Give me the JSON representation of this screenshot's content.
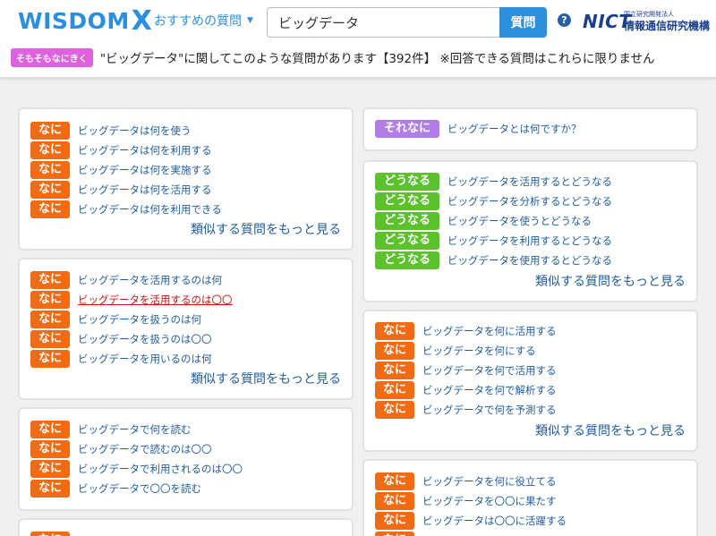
{
  "header": {
    "logo_text": "WISDOM",
    "logo_x": "X",
    "nav_dropdown": "おすすめの質問",
    "search_value": "ビッグデータ",
    "search_button": "質問",
    "help": "?",
    "nict_mark": "NICT",
    "nict_small": "国立研究開発法人",
    "nict_big": "情報通信研究機構"
  },
  "info_bar": {
    "badge": "そもそもなにきく",
    "text": "\"ビッグデータ\"に関してこのような質問があります【392件】 ※回答できる質問はこれらに限りません"
  },
  "colors": {
    "accent": "#2b8fe0",
    "tag_nani": "#f26a12",
    "tag_dounaru": "#5bc22c",
    "tag_sorenani": "#b07ee6",
    "link": "#1f5c9e",
    "visited_link": "#d01010"
  },
  "more_label": "類似する質問をもっと見る",
  "cards": [
    {
      "tag": "なに",
      "items": [
        "ビッグデータは何を使う",
        "ビッグデータは何を利用する",
        "ビッグデータは何を実施する",
        "ビッグデータは何を活用する",
        "ビッグデータは何を利用できる"
      ]
    },
    {
      "tag": "なに",
      "items": [
        "ビッグデータを活用するのは何",
        "ビッグデータを活用するのは〇〇",
        "ビッグデータを扱うのは何",
        "ビッグデータを扱うのは〇〇",
        "ビッグデータを用いるのは何"
      ]
    },
    {
      "tag": "なに",
      "items": [
        "ビッグデータで何を読む",
        "ビッグデータで読むのは〇〇",
        "ビッグデータで利用されるのは〇〇",
        "ビッグデータで〇〇を読む"
      ]
    },
    {
      "tag": "それなに",
      "items": [
        "ビッグデータとは何ですか？"
      ]
    },
    {
      "tag": "どうなる",
      "items": [
        "ビッグデータを活用するとどうなる",
        "ビッグデータを分析するとどうなる",
        "ビッグデータを使うとどうなる",
        "ビッグデータを利用するとどうなる",
        "ビッグデータを使用するとどうなる"
      ]
    },
    {
      "tag": "なに",
      "items": [
        "ビッグデータを何に活用する",
        "ビッグデータを何にする",
        "ビッグデータを何で活用する",
        "ビッグデータを何で解析する",
        "ビッグデータで何を予測する"
      ]
    },
    {
      "tag": "なに",
      "items": [
        "ビッグデータを何に役立てる",
        "ビッグデータを〇〇に果たす",
        "ビッグデータは〇〇に活躍する"
      ]
    },
    {
      "tag": "なに"
    }
  ]
}
